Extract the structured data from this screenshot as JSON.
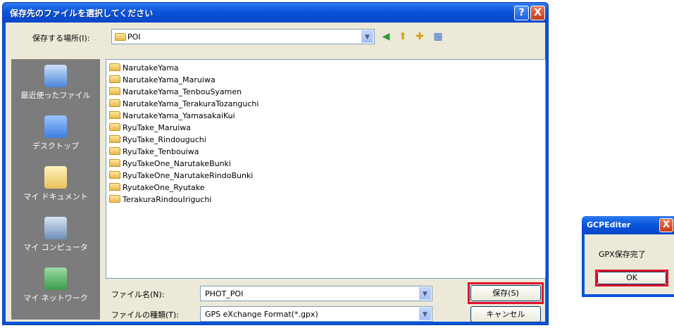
{
  "save_dialog": {
    "title": "保存先のファイルを選択してください",
    "help_label": "?",
    "close_label": "X",
    "location_label": "保存する場所(I):",
    "location_value": "POI",
    "places": [
      {
        "label": "最近使ったファイル",
        "icon": "recent-documents-icon",
        "color": "#4a86d8"
      },
      {
        "label": "デスクトップ",
        "icon": "desktop-icon",
        "color": "#3c7fe0"
      },
      {
        "label": "マイ ドキュメント",
        "icon": "my-documents-icon",
        "color": "#e8c35a"
      },
      {
        "label": "マイ コンピュータ",
        "icon": "my-computer-icon",
        "color": "#6f8fb8"
      },
      {
        "label": "マイ ネットワーク",
        "icon": "my-network-icon",
        "color": "#3b9b4a"
      }
    ],
    "files": [
      "NarutakeYama",
      "NarutakeYama_Maruiwa",
      "NarutakeYama_TenbouSyamen",
      "NarutakeYama_TerakuraTozanguchi",
      "NarutakeYama_YamasakaiKui",
      "RyuTake_Maruiwa",
      "RyuTake_Rindouguchi",
      "RyuTake_Tenbouiwa",
      "RyuTakeOne_NarutakeBunki",
      "RyuTakeOne_NarutakeRindoBunki",
      "RyutakeOne_Ryutake",
      "TerakuraRindouIriguchi"
    ],
    "filename_label": "ファイル名(N):",
    "filename_value": "PHOT_POI",
    "filetype_label": "ファイルの種類(T):",
    "filetype_value": "GPS eXchange Format(*.gpx)",
    "save_button": "保存(S)",
    "cancel_button": "キャンセル"
  },
  "message_box": {
    "title": "GCPEditer",
    "close_label": "X",
    "message": "GPX保存完了",
    "ok_button": "OK"
  },
  "colors": {
    "titlebar": "#0a54d8",
    "dialog_face": "#ece9d8",
    "places_bar": "#7c7c7c",
    "highlight": "#e0102a"
  }
}
